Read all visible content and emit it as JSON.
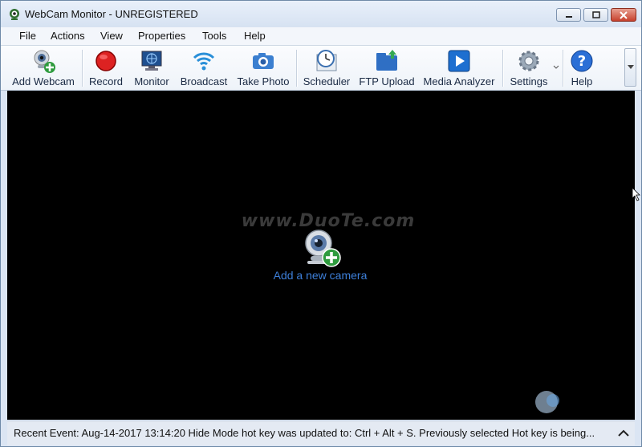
{
  "window": {
    "title": "WebCam Monitor - UNREGISTERED"
  },
  "menu": {
    "items": [
      "File",
      "Actions",
      "View",
      "Properties",
      "Tools",
      "Help"
    ]
  },
  "toolbar": {
    "buttons": [
      {
        "label": "Add Webcam",
        "icon": "add-webcam-icon"
      },
      {
        "label": "Record",
        "icon": "record-icon"
      },
      {
        "label": "Monitor",
        "icon": "monitor-icon"
      },
      {
        "label": "Broadcast",
        "icon": "broadcast-icon"
      },
      {
        "label": "Take Photo",
        "icon": "camera-icon"
      },
      {
        "label": "Scheduler",
        "icon": "clock-icon"
      },
      {
        "label": "FTP Upload",
        "icon": "ftp-upload-icon"
      },
      {
        "label": "Media Analyzer",
        "icon": "play-icon"
      },
      {
        "label": "Settings",
        "icon": "gear-icon"
      },
      {
        "label": "Help",
        "icon": "help-icon"
      }
    ]
  },
  "main": {
    "watermark": "www.DuoTe.com",
    "add_camera_label": "Add a new camera"
  },
  "status": {
    "text": "Recent Event: Aug-14-2017 13:14:20 Hide Mode hot key was updated to: Ctrl + Alt + S. Previously selected Hot key is being..."
  },
  "colors": {
    "accent": "#3d7fd9",
    "viewport": "#000000"
  }
}
